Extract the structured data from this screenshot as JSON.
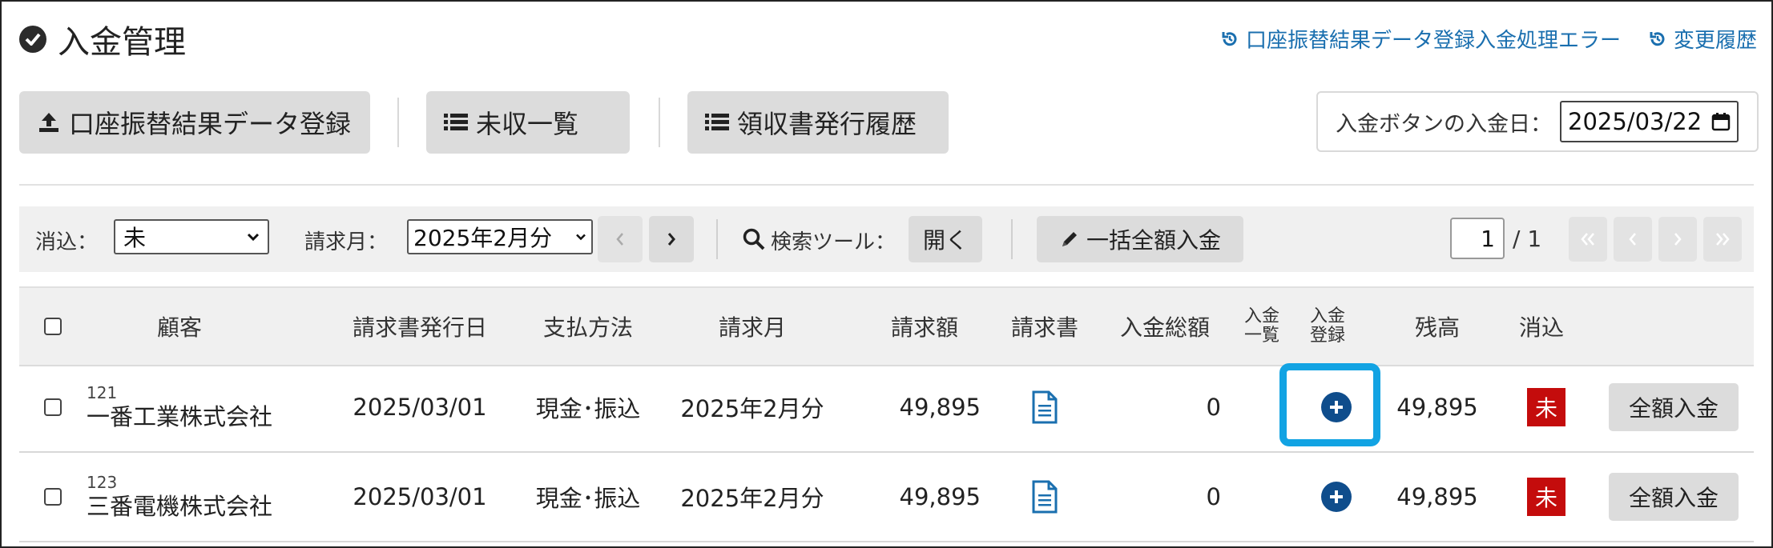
{
  "header": {
    "title": "入金管理",
    "links": [
      {
        "label": "口座振替結果データ登録入金処理エラー",
        "icon": "history-icon"
      },
      {
        "label": "変更履歴",
        "icon": "history-icon"
      }
    ]
  },
  "toolbar": {
    "upload_label": "口座振替結果データ登録",
    "unpaid_list_label": "未収一覧",
    "receipt_history_label": "領収書発行履歴",
    "deposit_date_label": "入金ボタンの入金日：",
    "deposit_date_value": "2025/03/22"
  },
  "filters": {
    "clearing_label": "消込：",
    "clearing_value": "未",
    "billing_month_label": "請求月：",
    "billing_month_value": "2025年2月分",
    "search_tool_label": "検索ツール：",
    "open_label": "開く",
    "bulk_pay_label": "一括全額入金",
    "current_page": "1",
    "total_pages": "/ 1"
  },
  "table": {
    "columns": {
      "customer": "顧客",
      "issue_date": "請求書発行日",
      "payment_method": "支払方法",
      "billing_month": "請求月",
      "amount": "請求額",
      "invoice": "請求書",
      "total_paid": "入金総額",
      "paid_list_1": "入金",
      "paid_list_2": "一覧",
      "paid_register_1": "入金",
      "paid_register_2": "登録",
      "balance": "残高",
      "cleared": "消込"
    },
    "rows": [
      {
        "customer_id": "121",
        "customer_name": "一番工業株式会社",
        "issue_date": "2025/03/01",
        "payment_method": "現金･振込",
        "billing_month": "2025年2月分",
        "amount": "49,895",
        "total_paid": "0",
        "balance": "49,895",
        "cleared": "未",
        "action": "全額入金"
      },
      {
        "customer_id": "123",
        "customer_name": "三番電機株式会社",
        "issue_date": "2025/03/01",
        "payment_method": "現金･振込",
        "billing_month": "2025年2月分",
        "amount": "49,895",
        "total_paid": "0",
        "balance": "49,895",
        "cleared": "未",
        "action": "全額入金"
      }
    ]
  },
  "colors": {
    "link": "#1a6faf",
    "badge_red": "#c40c0c",
    "highlight": "#12a3e3",
    "plus_icon": "#0f4d8c"
  }
}
